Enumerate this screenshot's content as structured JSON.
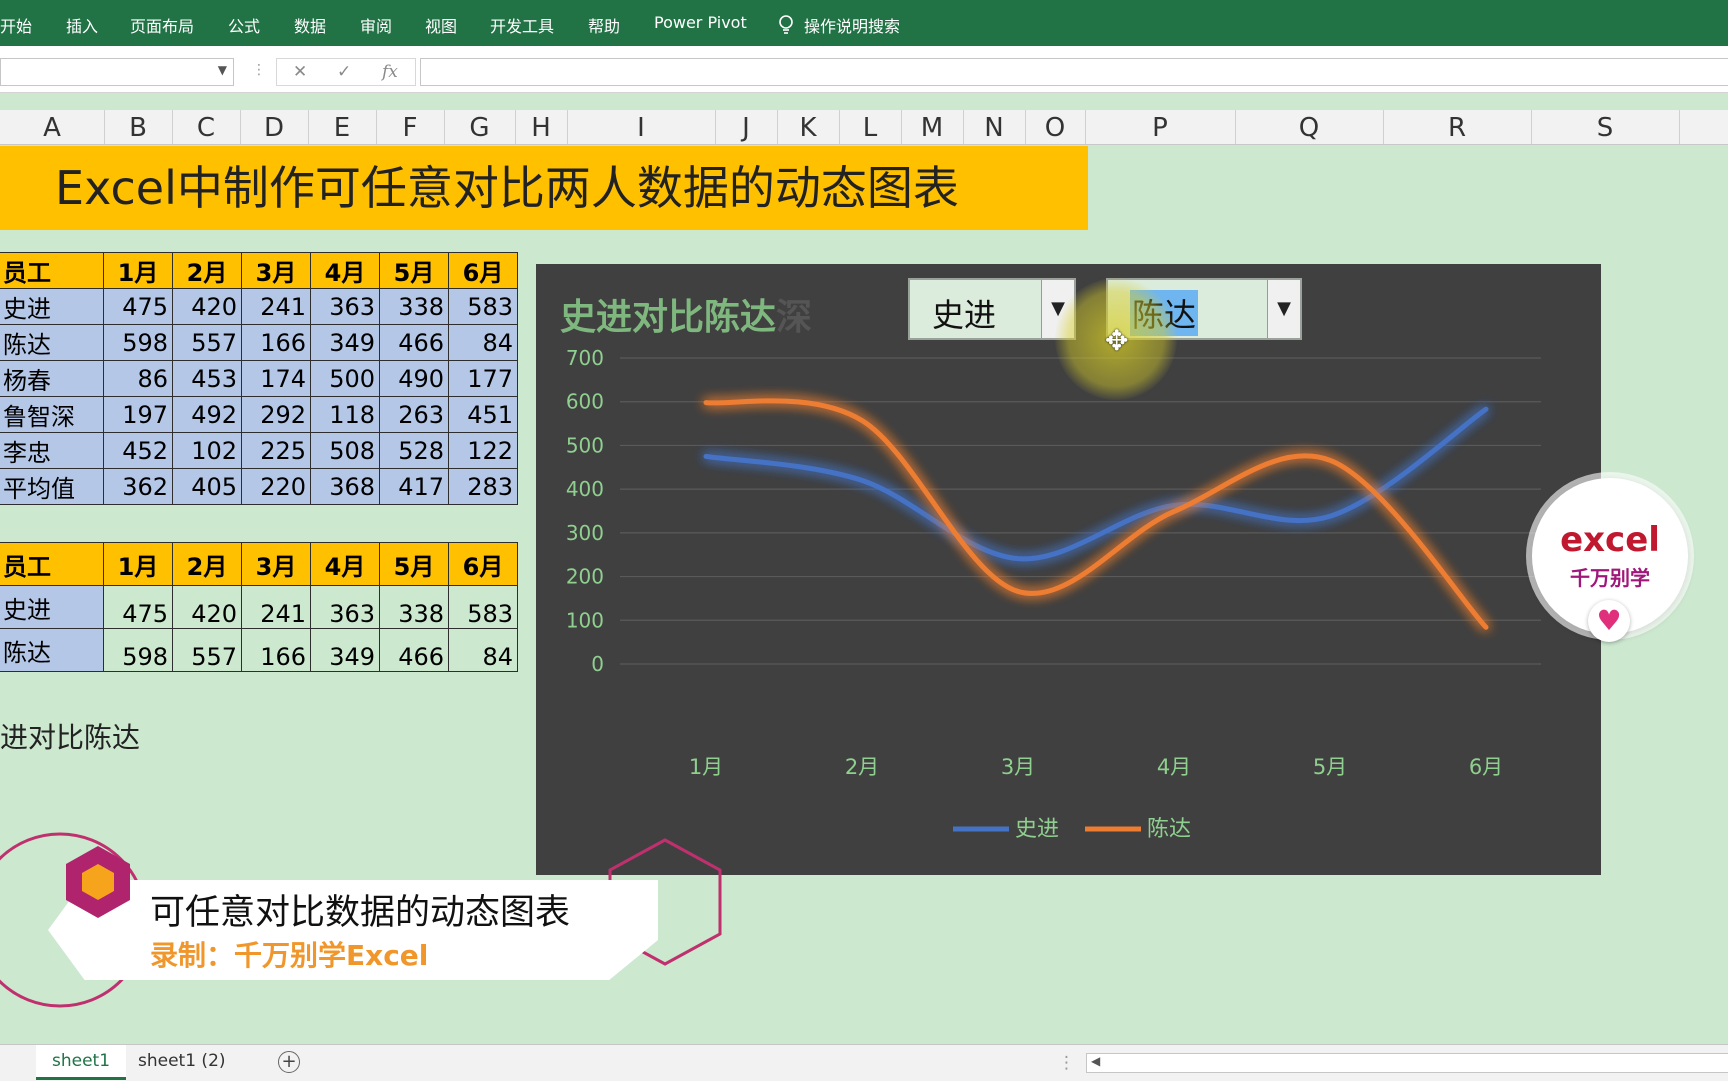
{
  "ribbon": {
    "tabs": [
      "开始",
      "插入",
      "页面布局",
      "公式",
      "数据",
      "审阅",
      "视图",
      "开发工具",
      "帮助",
      "Power Pivot"
    ],
    "tell_me": "操作说明搜索"
  },
  "formula_bar": {
    "name_box": "",
    "formula": ""
  },
  "columns": [
    "A",
    "B",
    "C",
    "D",
    "E",
    "F",
    "G",
    "H",
    "I",
    "J",
    "K",
    "L",
    "M",
    "N",
    "O",
    "P",
    "Q",
    "R",
    "S"
  ],
  "title_banner": "Excel中制作可任意对比两人数据的动态图表",
  "table1": {
    "headers": [
      "员工",
      "1月",
      "2月",
      "3月",
      "4月",
      "5月",
      "6月"
    ],
    "rows": [
      {
        "name": "史进",
        "values": [
          "475",
          "420",
          "241",
          "363",
          "338",
          "583"
        ]
      },
      {
        "name": "陈达",
        "values": [
          "598",
          "557",
          "166",
          "349",
          "466",
          "84"
        ]
      },
      {
        "name": "杨春",
        "values": [
          "86",
          "453",
          "174",
          "500",
          "490",
          "177"
        ]
      },
      {
        "name": "鲁智深",
        "values": [
          "197",
          "492",
          "292",
          "118",
          "263",
          "451"
        ]
      },
      {
        "name": "李忠",
        "values": [
          "452",
          "102",
          "225",
          "508",
          "528",
          "122"
        ]
      },
      {
        "name": "平均值",
        "values": [
          "362",
          "405",
          "220",
          "368",
          "417",
          "283"
        ]
      }
    ]
  },
  "table2": {
    "headers": [
      "员工",
      "1月",
      "2月",
      "3月",
      "4月",
      "5月",
      "6月"
    ],
    "rows": [
      {
        "name": "史进",
        "values": [
          "475",
          "420",
          "241",
          "363",
          "338",
          "583"
        ]
      },
      {
        "name": "陈达",
        "values": [
          "598",
          "557",
          "166",
          "349",
          "466",
          "84"
        ]
      }
    ]
  },
  "caption_cell": "进对比陈达",
  "chart": {
    "title": "史进对比陈达",
    "title_ghost": "深",
    "combo1": "史进",
    "combo2": "陈达"
  },
  "chart_data": {
    "type": "line",
    "title": "史进对比陈达",
    "categories": [
      "1月",
      "2月",
      "3月",
      "4月",
      "5月",
      "6月"
    ],
    "series": [
      {
        "name": "史进",
        "values": [
          475,
          420,
          241,
          363,
          338,
          583
        ],
        "color": "#4472c4"
      },
      {
        "name": "陈达",
        "values": [
          598,
          557,
          166,
          349,
          466,
          84
        ],
        "color": "#ed7d31"
      }
    ],
    "ylim": [
      0,
      700
    ],
    "yticks": [
      0,
      100,
      200,
      300,
      400,
      500,
      600,
      700
    ],
    "grid": true,
    "legend": "bottom",
    "smooth": true
  },
  "badge": {
    "line1": "excel",
    "line2": "千万别学"
  },
  "lower_third": {
    "title": "可任意对比数据的动态图表",
    "subtitle": "录制：千万别学Excel"
  },
  "sheets": [
    "sheet1",
    "sheet1 (2)"
  ],
  "colors": {
    "ribbon": "#217346",
    "header_fill": "#ffc000",
    "row_fill": "#b4c7e7",
    "sheet_bg": "#cce8cf",
    "chart_bg": "#404040"
  }
}
